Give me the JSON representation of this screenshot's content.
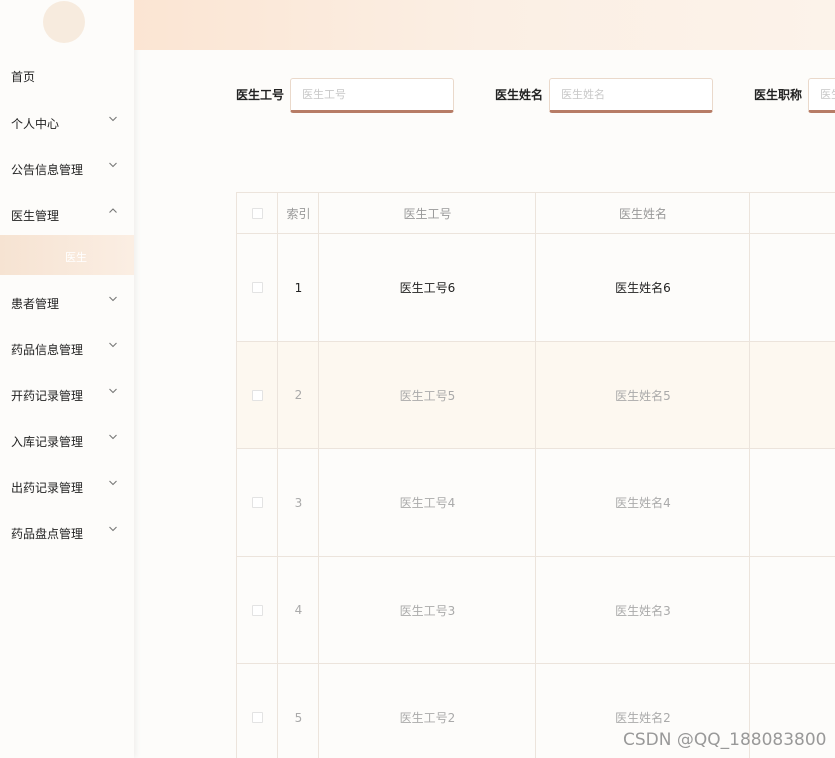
{
  "sidebar": {
    "items": [
      {
        "label": "首页",
        "has_chevron": false
      },
      {
        "label": "个人中心",
        "has_chevron": true,
        "chevron": "down"
      },
      {
        "label": "公告信息管理",
        "has_chevron": true,
        "chevron": "down"
      },
      {
        "label": "医生管理",
        "has_chevron": true,
        "chevron": "up",
        "expanded": true
      },
      {
        "label": "患者管理",
        "has_chevron": true,
        "chevron": "down"
      },
      {
        "label": "药品信息管理",
        "has_chevron": true,
        "chevron": "down"
      },
      {
        "label": "开药记录管理",
        "has_chevron": true,
        "chevron": "down"
      },
      {
        "label": "入库记录管理",
        "has_chevron": true,
        "chevron": "down"
      },
      {
        "label": "出药记录管理",
        "has_chevron": true,
        "chevron": "down"
      },
      {
        "label": "药品盘点管理",
        "has_chevron": true,
        "chevron": "down"
      }
    ],
    "submenu": {
      "label": "医生",
      "active": true
    }
  },
  "search": {
    "fields": [
      {
        "label": "医生工号",
        "placeholder": "医生工号",
        "value": ""
      },
      {
        "label": "医生姓名",
        "placeholder": "医生姓名",
        "value": ""
      },
      {
        "label": "医生职称",
        "placeholder": "医生职称",
        "value": ""
      }
    ]
  },
  "table": {
    "headers": [
      "",
      "索引",
      "医生工号",
      "医生姓名"
    ],
    "rows": [
      {
        "index": "1",
        "doctor_id": "医生工号6",
        "doctor_name": "医生姓名6"
      },
      {
        "index": "2",
        "doctor_id": "医生工号5",
        "doctor_name": "医生姓名5"
      },
      {
        "index": "3",
        "doctor_id": "医生工号4",
        "doctor_name": "医生姓名4"
      },
      {
        "index": "4",
        "doctor_id": "医生工号3",
        "doctor_name": "医生姓名3"
      },
      {
        "index": "5",
        "doctor_id": "医生工号2",
        "doctor_name": "医生姓名2"
      }
    ]
  },
  "watermark": "CSDN @QQ_188083800",
  "colors": {
    "accent": "#b77c66",
    "topbar_start": "#fbe5d3",
    "submenu_bg": "#f6e3d2",
    "row_alt": "#fdf8f0"
  }
}
